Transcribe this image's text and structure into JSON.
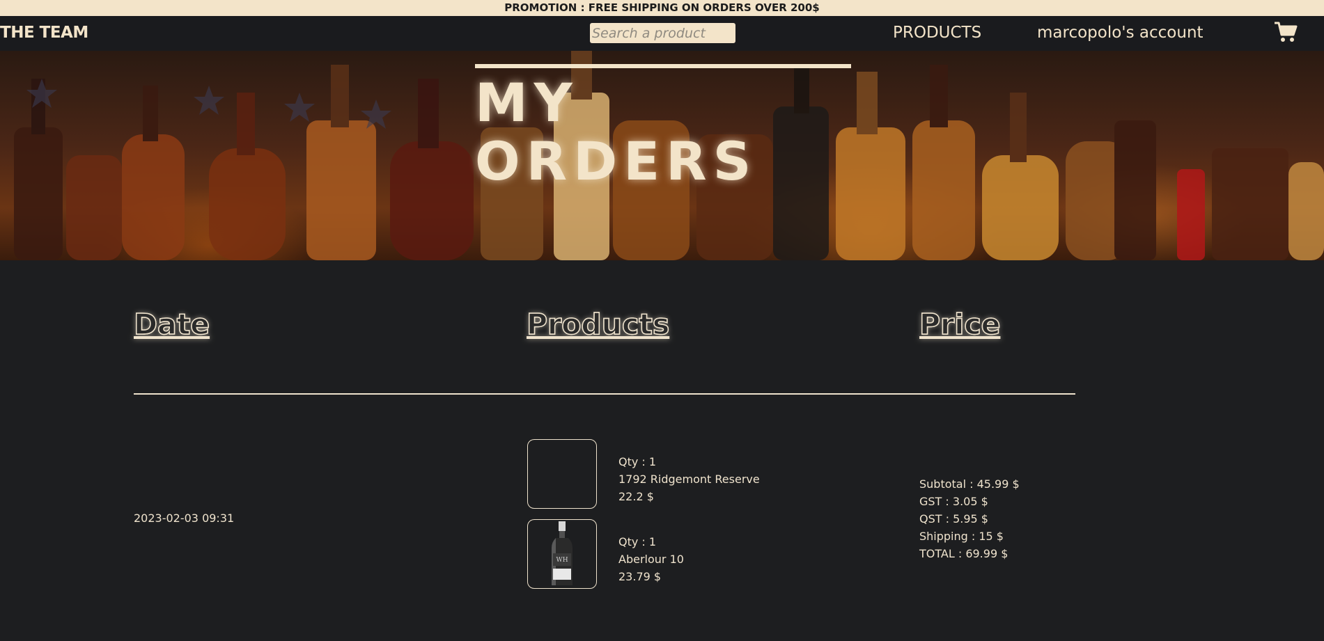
{
  "promo": {
    "text": "PROMOTION : FREE SHIPPING ON ORDERS OVER 200$"
  },
  "nav": {
    "brand": "THE TEAM",
    "search_placeholder": "Search a product",
    "products_label": "PRODUCTS",
    "account_label": "marcopolo's account",
    "cart_icon": "cart-icon"
  },
  "hero": {
    "title": "MY ORDERS"
  },
  "table": {
    "headers": {
      "date": "Date",
      "products": "Products",
      "price": "Price"
    }
  },
  "order": {
    "date": "2023-02-03 09:31",
    "items": [
      {
        "qty": "Qty : 1",
        "name": "1792 Ridgemont Reserve",
        "price": "22.2 $"
      },
      {
        "qty": "Qty : 1",
        "name": "Aberlour 10",
        "price": "23.79 $"
      }
    ],
    "totals": {
      "subtotal": "Subtotal : 45.99 $",
      "gst": "GST : 3.05 $",
      "qst": "QST : 5.95 $",
      "shipping": "Shipping : 15 $",
      "total": "TOTAL : 69.99 $"
    }
  },
  "colors": {
    "cream": "#f3e4c9",
    "background": "#1d1e20",
    "navbar": "#1a1b1e"
  }
}
